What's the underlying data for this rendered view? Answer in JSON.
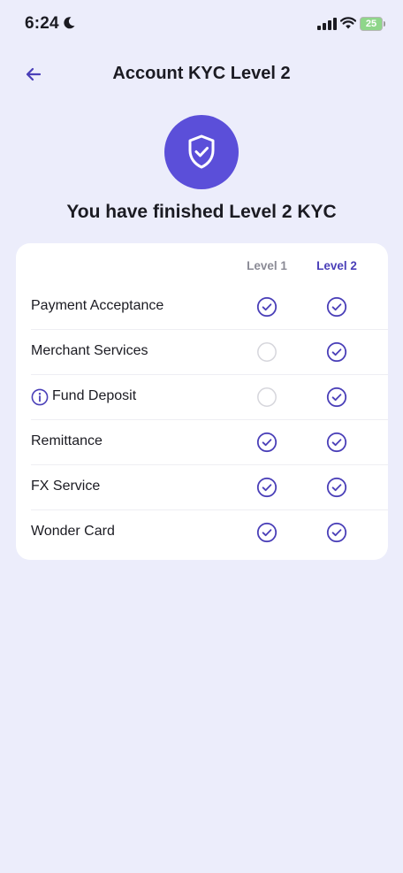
{
  "status_bar": {
    "time": "6:24",
    "battery": "25",
    "battery_color": "#8fd68a",
    "icons": [
      "moon-icon",
      "signal-icon",
      "wifi-icon",
      "battery-icon"
    ]
  },
  "header": {
    "title": "Account KYC Level 2",
    "back_icon": "arrow-left-icon"
  },
  "hero": {
    "badge_icon": "shield-check-icon",
    "message": "You have finished Level 2 KYC",
    "accent_color": "#5b4fd9"
  },
  "table": {
    "columns": [
      "Level 1",
      "Level 2"
    ],
    "rows": [
      {
        "label": "Payment Acceptance",
        "info": false,
        "level1": true,
        "level2": true
      },
      {
        "label": "Merchant Services",
        "info": false,
        "level1": false,
        "level2": true
      },
      {
        "label": "Fund Deposit",
        "info": true,
        "level1": false,
        "level2": true
      },
      {
        "label": "Remittance",
        "info": false,
        "level1": true,
        "level2": true
      },
      {
        "label": "FX Service",
        "info": false,
        "level1": true,
        "level2": true
      },
      {
        "label": "Wonder Card",
        "info": false,
        "level1": true,
        "level2": true
      }
    ]
  }
}
